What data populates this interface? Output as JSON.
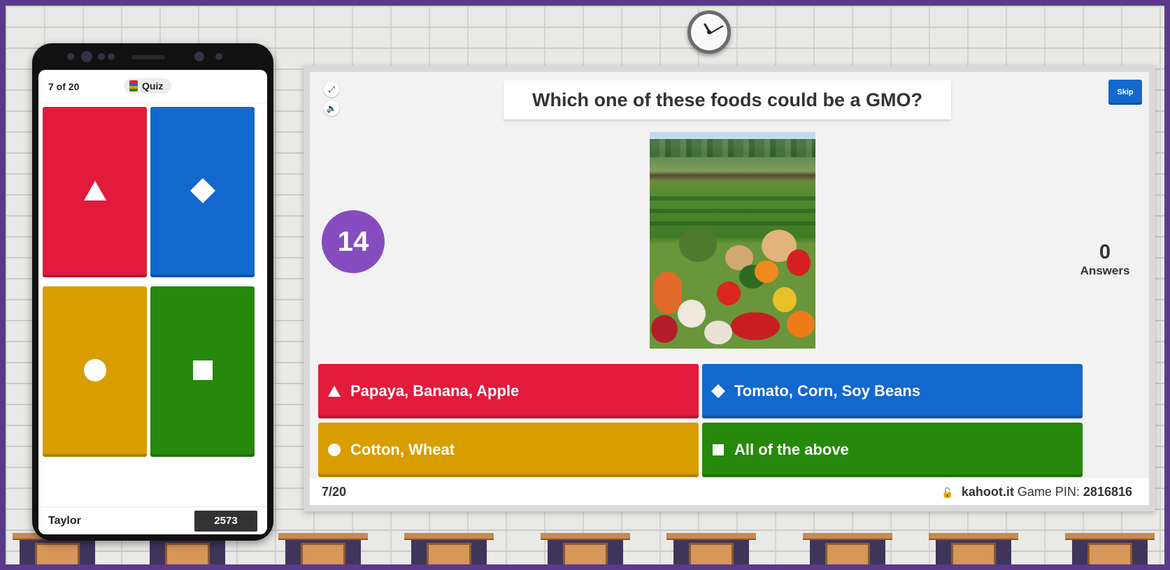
{
  "colors": {
    "red": "#e21b3c",
    "blue": "#1368ce",
    "yellow": "#d89e00",
    "green": "#26890c",
    "timer": "#864cbf"
  },
  "phone": {
    "progress": "7 of 20",
    "mode_label": "Quiz",
    "player_name": "Taylor",
    "score": "2573"
  },
  "board": {
    "question": "Which one of these foods could be a GMO?",
    "skip_label": "Skip",
    "timer": "14",
    "answer_count": "0",
    "answer_count_label": "Answers",
    "answers": [
      {
        "label": "Papaya, Banana, Apple",
        "shape": "triangle-icon"
      },
      {
        "label": "Tomato, Corn, Soy Beans",
        "shape": "diamond-icon"
      },
      {
        "label": "Cotton, Wheat",
        "shape": "circle-icon"
      },
      {
        "label": "All of the above",
        "shape": "square-icon"
      }
    ],
    "footer": {
      "progress": "7/20",
      "site": "kahoot.it",
      "pin_label": "Game PIN:",
      "pin": "2816816"
    }
  }
}
